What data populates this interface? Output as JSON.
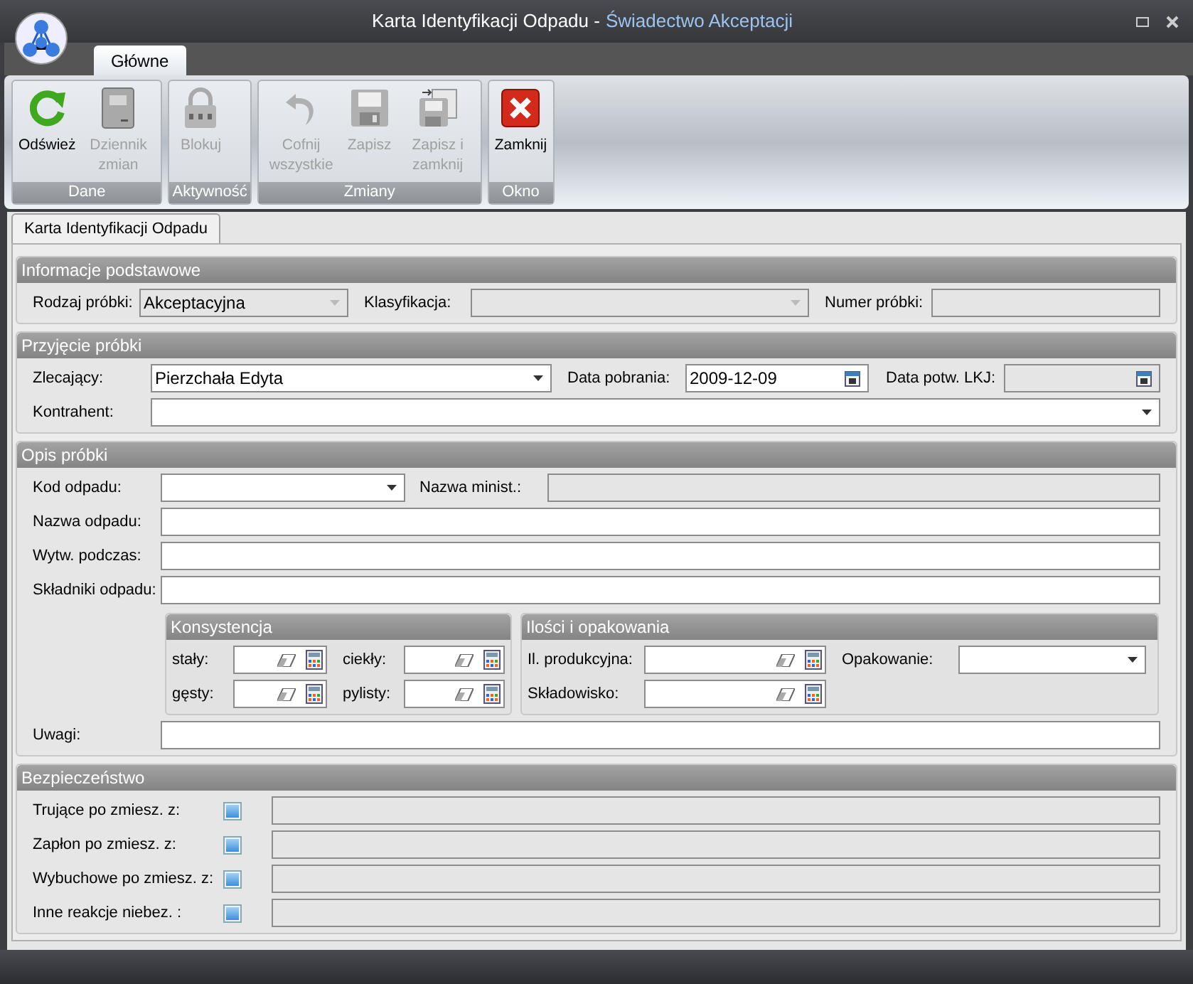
{
  "window": {
    "title": "Karta Identyfikacji Odpadu -",
    "subtitle": "Świadectwo Akceptacji"
  },
  "ribbon_tabs": [
    {
      "label": "Główne",
      "selected": true
    }
  ],
  "ribbon_groups": [
    {
      "label": "Dane",
      "buttons": [
        {
          "label": "Odśwież",
          "kind": "refresh",
          "disabled": false
        },
        {
          "label": "Dziennik zmian",
          "kind": "journal",
          "disabled": true
        }
      ]
    },
    {
      "label": "Aktywność",
      "buttons": [
        {
          "label": "Blokuj",
          "kind": "lock",
          "disabled": true
        }
      ]
    },
    {
      "label": "Zmiany",
      "buttons": [
        {
          "label": "Cofnij wszystkie",
          "kind": "undo",
          "disabled": true
        },
        {
          "label": "Zapisz",
          "kind": "save",
          "disabled": true
        },
        {
          "label": "Zapisz i zamknij",
          "kind": "save_close",
          "disabled": true
        }
      ]
    },
    {
      "label": "Okno",
      "buttons": [
        {
          "label": "Zamknij",
          "kind": "close",
          "disabled": false
        }
      ]
    }
  ],
  "doc_tabs": [
    {
      "label": "Karta Identyfikacji Odpadu",
      "selected": true
    }
  ],
  "sections": [
    {
      "title": "Informacje podstawowe",
      "rows": [
        [
          {
            "label": "Rodzaj próbki:",
            "kind": "combo",
            "value": "Akceptacyjna",
            "disabled": true
          },
          {
            "label": "Klasyfikacja:",
            "kind": "combo",
            "disabled": true
          },
          {
            "label": "Numer próbki:",
            "kind": "text",
            "disabled": true
          }
        ]
      ]
    },
    {
      "title": "Przyjęcie próbki",
      "rows": [
        [
          {
            "label": "Zlecający:",
            "kind": "combo",
            "value": "Pierzchała Edyta",
            "disabled": false
          },
          {
            "label": "Data pobrania:",
            "kind": "date",
            "value": "2009-12-09",
            "disabled": false
          },
          {
            "label": "Data potw. LKJ:",
            "kind": "date",
            "disabled": true
          }
        ],
        [
          {
            "label": "Kontrahent:",
            "kind": "combo",
            "disabled": false
          }
        ]
      ]
    },
    {
      "title": "Opis próbki",
      "rows": [
        [
          {
            "label": "Kod odpadu:",
            "kind": "combo",
            "disabled": false
          },
          {
            "label": "Nazwa minist.:",
            "kind": "text",
            "disabled": true
          }
        ],
        [
          {
            "label": "Nazwa odpadu:",
            "kind": "text",
            "disabled": false
          }
        ],
        [
          {
            "label": "Wytw. podczas:",
            "kind": "text",
            "disabled": false
          }
        ],
        [
          {
            "label": "Składniki odpadu:",
            "kind": "text",
            "disabled": false
          }
        ]
      ],
      "groups": [
        {
          "title": "Konsystencja",
          "rows": [
            [
              {
                "label": "stały:",
                "kind": "calc",
                "disabled": false
              },
              {
                "label": "ciekły:",
                "kind": "calc",
                "disabled": false
              }
            ],
            [
              {
                "label": "gęsty:",
                "kind": "calc",
                "disabled": false
              },
              {
                "label": "pylisty:",
                "kind": "calc",
                "disabled": false
              }
            ]
          ]
        },
        {
          "title": "Ilości i opakowania",
          "rows": [
            [
              {
                "label": "Il. produkcyjna:",
                "kind": "calc",
                "disabled": false
              },
              {
                "label": "Opakowanie:",
                "kind": "combo",
                "disabled": false
              }
            ],
            [
              {
                "label": "Składowisko:",
                "kind": "calc",
                "disabled": false
              }
            ]
          ]
        }
      ],
      "notes": {
        "label": "Uwagi:",
        "kind": "text",
        "disabled": false
      }
    },
    {
      "title": "Bezpieczeństwo",
      "rows": [
        [
          {
            "label": "Trujące po zmiesz. z:",
            "kind": "check",
            "checked": false
          },
          {
            "kind": "text",
            "disabled": true
          }
        ],
        [
          {
            "label": "Zapłon po zmiesz. z:",
            "kind": "check",
            "checked": false
          },
          {
            "kind": "text",
            "disabled": true
          }
        ],
        [
          {
            "label": "Wybuchowe po zmiesz. z:",
            "kind": "check",
            "checked": false
          },
          {
            "kind": "text",
            "disabled": true
          }
        ],
        [
          {
            "label": "Inne reakcje niebez. :",
            "kind": "check",
            "checked": false
          },
          {
            "kind": "text",
            "disabled": true
          }
        ]
      ]
    }
  ]
}
